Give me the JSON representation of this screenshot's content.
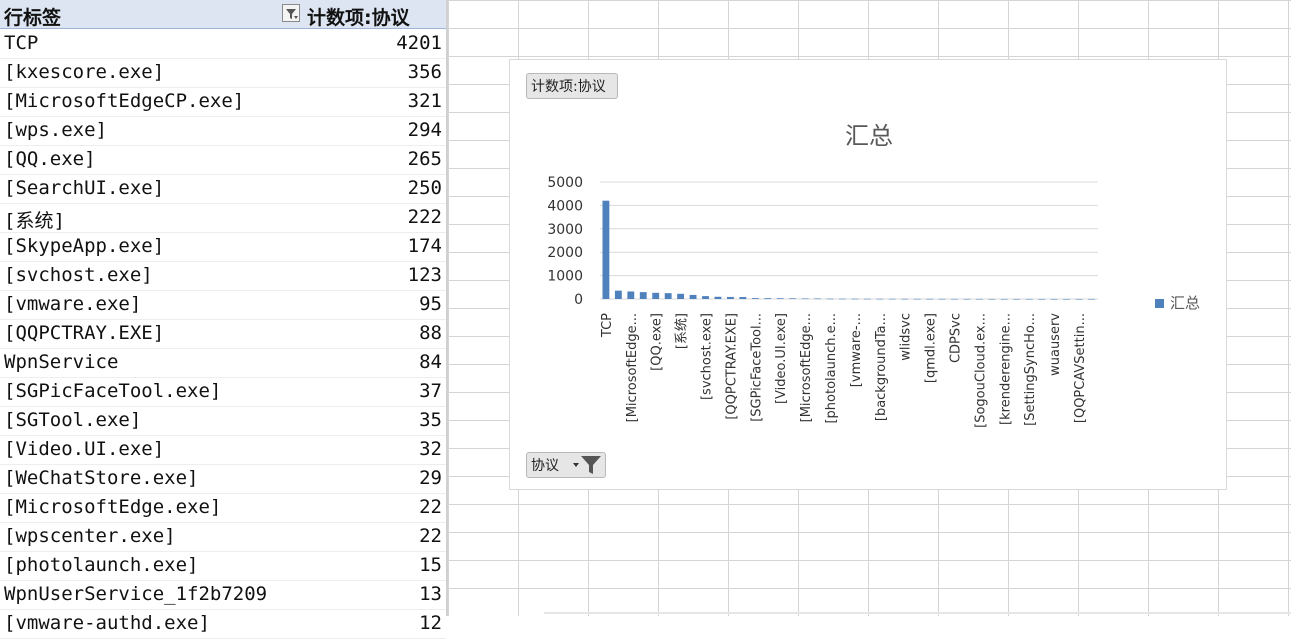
{
  "pivot": {
    "header_label": "行标签",
    "header_count": "计数项:协议",
    "rows": [
      {
        "name": "TCP",
        "count": "4201"
      },
      {
        "name": "[kxescore.exe]",
        "count": "356"
      },
      {
        "name": "[MicrosoftEdgeCP.exe]",
        "count": "321"
      },
      {
        "name": "[wps.exe]",
        "count": "294"
      },
      {
        "name": "[QQ.exe]",
        "count": "265"
      },
      {
        "name": "[SearchUI.exe]",
        "count": "250"
      },
      {
        "name": "[系统]",
        "count": "222"
      },
      {
        "name": "[SkypeApp.exe]",
        "count": "174"
      },
      {
        "name": "[svchost.exe]",
        "count": "123"
      },
      {
        "name": "[vmware.exe]",
        "count": "95"
      },
      {
        "name": "[QQPCTRAY.EXE]",
        "count": "88"
      },
      {
        "name": "WpnService",
        "count": "84"
      },
      {
        "name": "[SGPicFaceTool.exe]",
        "count": "37"
      },
      {
        "name": "[SGTool.exe]",
        "count": "35"
      },
      {
        "name": "[Video.UI.exe]",
        "count": "32"
      },
      {
        "name": "[WeChatStore.exe]",
        "count": "29"
      },
      {
        "name": "[MicrosoftEdge.exe]",
        "count": "22"
      },
      {
        "name": "[wpscenter.exe]",
        "count": "22"
      },
      {
        "name": "[photolaunch.exe]",
        "count": "15"
      },
      {
        "name": "WpnUserService_1f2b7209",
        "count": "13"
      },
      {
        "name": "[vmware-authd.exe]",
        "count": "12"
      }
    ]
  },
  "chart": {
    "value_field_button": "计数项:协议",
    "axis_field_button": "协议"
  },
  "chart_data": {
    "type": "bar",
    "title": "汇总",
    "legend": "right",
    "legend_entries": [
      "汇总"
    ],
    "ylim": [
      0,
      5000
    ],
    "yticks": [
      "5000",
      "4000",
      "3000",
      "2000",
      "1000",
      "0"
    ],
    "grid": true,
    "tick_labels": [
      "TCP",
      "[MicrosoftEdge...",
      "[QQ.exe]",
      "[系统]",
      "[svchost.exe]",
      "[QQPCTRAY.EXE]",
      "[SGPicFaceTool...",
      "[Video.UI.exe]",
      "[MicrosoftEdge...",
      "[photolaunch.e...",
      "[vmware-...",
      "[backgroundTa...",
      "wlidsvc",
      "[qmdl.exe]",
      "CDPSvc",
      "[SogouCloud.ex...",
      "[krenderengine...",
      "[SettingSyncHo...",
      "wuauserv",
      "[QQPCAVSettin..."
    ],
    "series": [
      {
        "name": "汇总",
        "values": [
          4201,
          356,
          321,
          294,
          265,
          250,
          222,
          174,
          123,
          95,
          88,
          84,
          37,
          35,
          32,
          29,
          22,
          22,
          15,
          13,
          12,
          11,
          10,
          9,
          8,
          7,
          6,
          6,
          5,
          5,
          4,
          4,
          3,
          3,
          3,
          2,
          2,
          2,
          2,
          2
        ]
      }
    ]
  },
  "colors": {
    "bar": "#4f81bd",
    "header_bg": "#dde5f2",
    "gridline": "#d9d9d9"
  }
}
